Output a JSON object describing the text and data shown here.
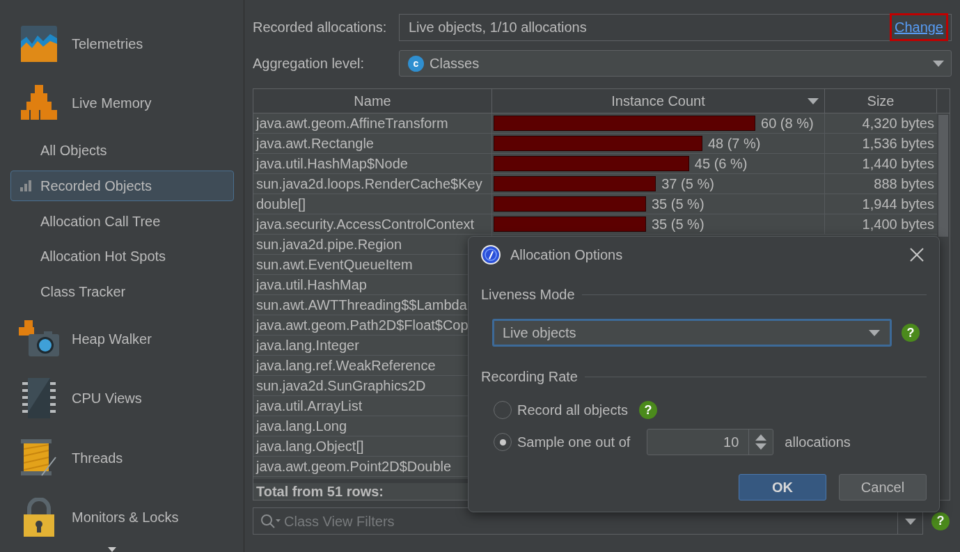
{
  "sidebar": {
    "items": [
      {
        "kind": "section",
        "label": "Telemetries",
        "selected": false
      },
      {
        "kind": "section",
        "label": "Live Memory",
        "selected": false
      },
      {
        "kind": "view",
        "label": "All Objects",
        "selected": false
      },
      {
        "kind": "view",
        "label": "Recorded Objects",
        "selected": true
      },
      {
        "kind": "view",
        "label": "Allocation Call Tree",
        "selected": false
      },
      {
        "kind": "view",
        "label": "Allocation Hot Spots",
        "selected": false
      },
      {
        "kind": "view",
        "label": "Class Tracker",
        "selected": false
      },
      {
        "kind": "section",
        "label": "Heap Walker",
        "selected": false
      },
      {
        "kind": "section",
        "label": "CPU Views",
        "selected": false
      },
      {
        "kind": "section",
        "label": "Threads",
        "selected": false
      },
      {
        "kind": "section",
        "label": "Monitors & Locks",
        "selected": false
      }
    ]
  },
  "recorded_allocations": {
    "label": "Recorded allocations:",
    "value": "Live objects, 1/10 allocations",
    "link": "Change"
  },
  "aggregation_level": {
    "label": "Aggregation level:",
    "value": "Classes",
    "icon_letter": "c"
  },
  "table": {
    "columns": [
      {
        "label": "Name",
        "sorted": false
      },
      {
        "label": "Instance Count",
        "sorted": true
      },
      {
        "label": "Size",
        "sorted": false
      }
    ],
    "rows": [
      {
        "name": "java.awt.geom.AffineTransform",
        "count": "60 (8 %)",
        "level": 0.79,
        "size": "4,320 bytes"
      },
      {
        "name": "java.awt.Rectangle",
        "count": "48 (7 %)",
        "level": 0.63,
        "size": "1,536 bytes"
      },
      {
        "name": "java.util.HashMap$Node",
        "count": "45 (6 %)",
        "level": 0.59,
        "size": "1,440 bytes"
      },
      {
        "name": "sun.java2d.loops.RenderCache$Key",
        "count": "37 (5 %)",
        "level": 0.49,
        "size": "888 bytes"
      },
      {
        "name": "double[]",
        "count": "35 (5 %)",
        "level": 0.46,
        "size": "1,944 bytes"
      },
      {
        "name": "java.security.AccessControlContext",
        "count": "35 (5 %)",
        "level": 0.46,
        "size": "1,400 bytes"
      },
      {
        "name": "sun.java2d.pipe.Region"
      },
      {
        "name": "sun.awt.EventQueueItem"
      },
      {
        "name": "java.util.HashMap"
      },
      {
        "name": "sun.awt.AWTThreading$$Lambda"
      },
      {
        "name": "java.awt.geom.Path2D$Float$Cop"
      },
      {
        "name": "java.lang.Integer"
      },
      {
        "name": "java.lang.ref.WeakReference"
      },
      {
        "name": "sun.java2d.SunGraphics2D"
      },
      {
        "name": "java.util.ArrayList"
      },
      {
        "name": "java.lang.Long"
      },
      {
        "name": "java.lang.Object[]"
      },
      {
        "name": "java.awt.geom.Point2D$Double"
      }
    ],
    "total": "Total from 51 rows:"
  },
  "filter": {
    "placeholder": "Class View Filters",
    "help": "?"
  },
  "dialog": {
    "title": "Allocation Options",
    "liveness": {
      "heading": "Liveness Mode",
      "value": "Live objects",
      "help": "?"
    },
    "rate": {
      "heading": "Recording Rate",
      "options": [
        {
          "label": "Record all objects",
          "selected": false,
          "help": "?"
        },
        {
          "label": "Sample one out of",
          "selected": true
        }
      ],
      "spinner": "10",
      "suffix": "allocations"
    },
    "buttons": [
      {
        "label": "OK",
        "kind": "primary"
      },
      {
        "label": "Cancel",
        "kind": "secondary"
      }
    ]
  }
}
